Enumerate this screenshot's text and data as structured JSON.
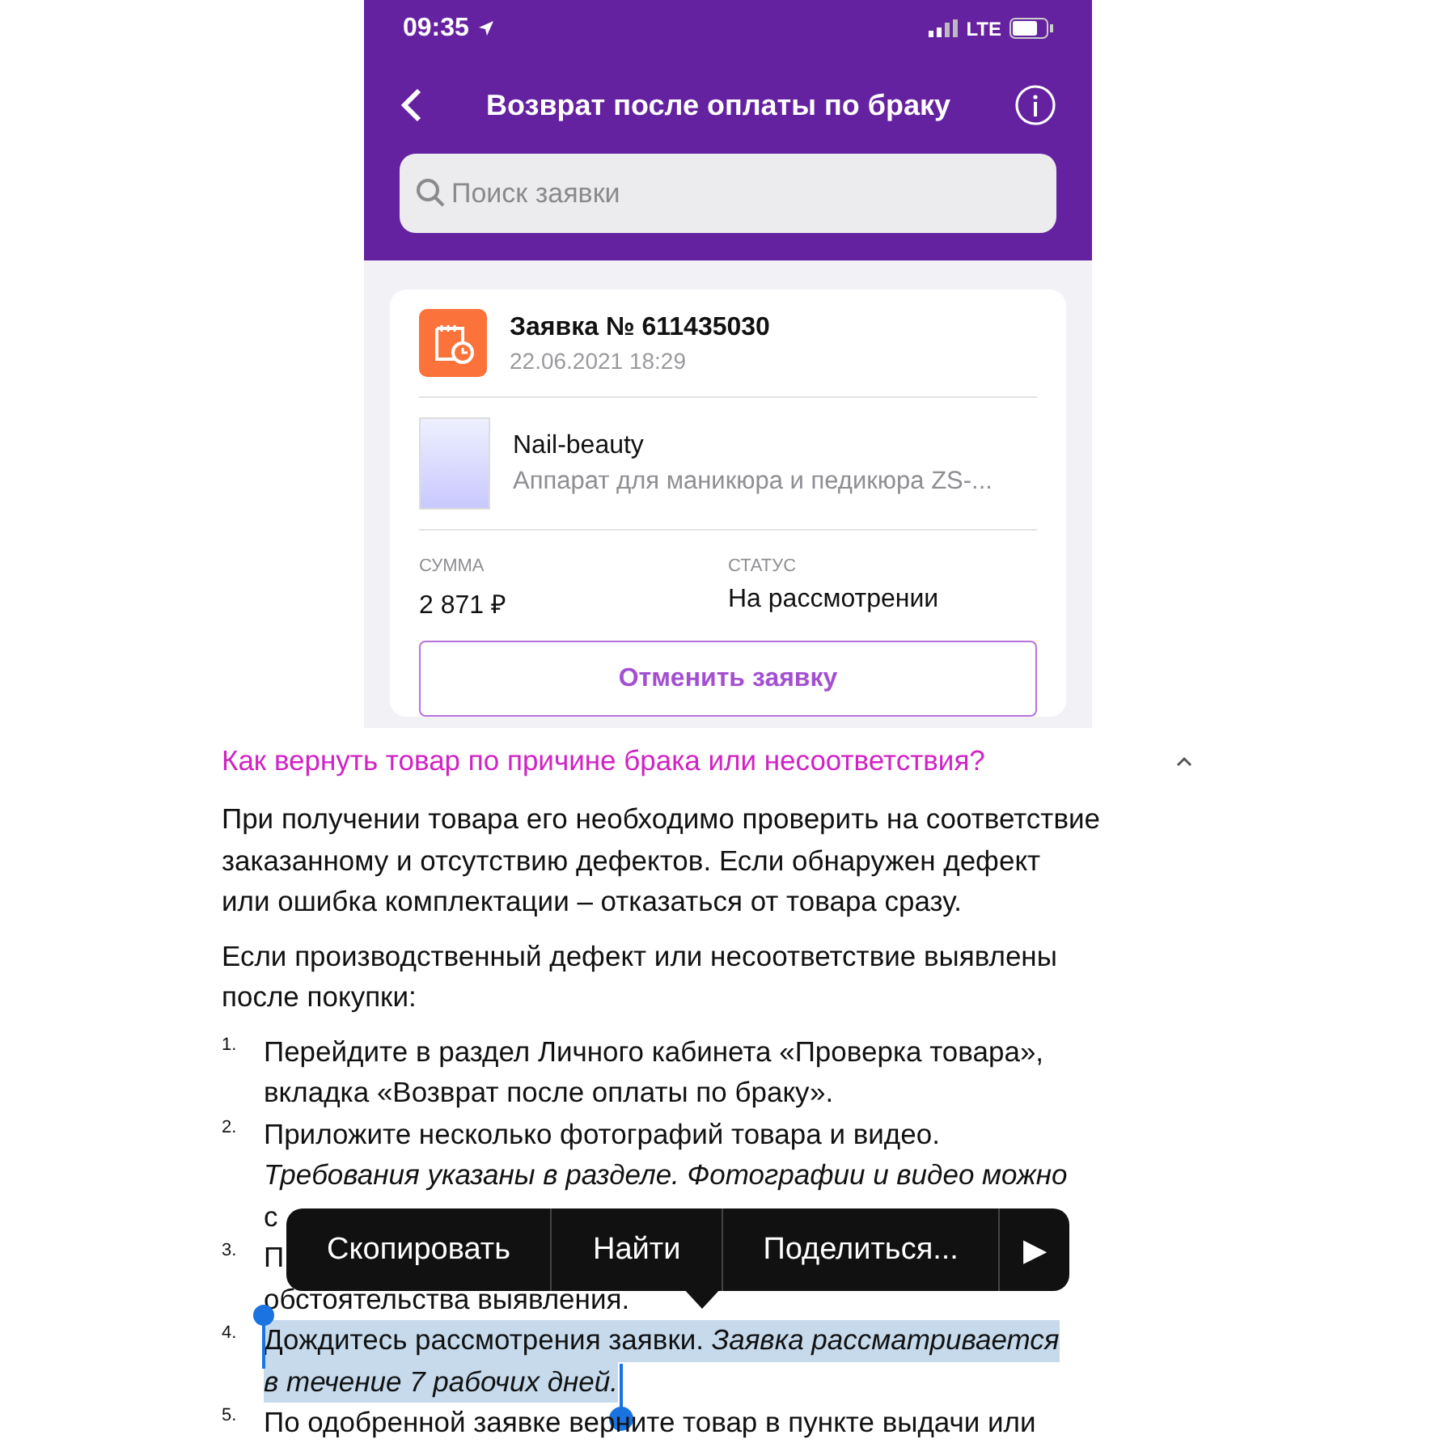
{
  "status_bar": {
    "time": "09:35",
    "network": "LTE"
  },
  "nav": {
    "title": "Возврат после оплаты по браку"
  },
  "search": {
    "placeholder": "Поиск заявки"
  },
  "request": {
    "title": "Заявка № 611435030",
    "date": "22.06.2021 18:29",
    "seller": "Nail-beauty",
    "product": "Аппарат для маникюра и педикюра ZS-...",
    "fields": [
      {
        "label": "СУММА",
        "value": "2 871 ₽"
      },
      {
        "label": "СТАТУС",
        "value": "На рассмотрении"
      }
    ],
    "cancel_button": "Отменить заявку"
  },
  "faq": {
    "question": "Как вернуть товар по причине брака или несоответствия?",
    "expanded": true,
    "paragraphs": [
      [
        "При получении товара его необходимо проверить на соответствие",
        "заказанному и отсутствию дефектов. Если обнаружен дефект",
        "или ошибка комплектации – отказаться от товара сразу."
      ],
      [
        "Если производственный дефект или несоответствие выявлены",
        "после покупки:"
      ]
    ],
    "steps": [
      {
        "number": "1.",
        "highlighted": false,
        "lines": [
          "Перейдите в раздел Личного кабинета «Проверка товара»,",
          "вкладка «Возврат после оплаты по браку»."
        ]
      },
      {
        "number": "2.",
        "highlighted": false,
        "lines": [
          "Приложите несколько фотографий товара и видео.",
          "*Требования указаны в разделе. Фотографии и видео можно*",
          "с"
        ]
      },
      {
        "number": "3.",
        "highlighted": false,
        "lines": [
          "П",
          "обстоятельства выявления."
        ]
      },
      {
        "number": "4.",
        "highlighted": true,
        "lines": [
          "Дождитесь рассмотрения заявки. *Заявка рассматривается*",
          "*в течение 7 рабочих дней.*"
        ]
      },
      {
        "number": "5.",
        "highlighted": false,
        "lines": [
          "По одобренной заявке верните товар в пункте выдачи или"
        ]
      }
    ]
  },
  "context_menu": {
    "items": [
      "Скопировать",
      "Найти",
      "Поделиться..."
    ],
    "more": "▶"
  }
}
